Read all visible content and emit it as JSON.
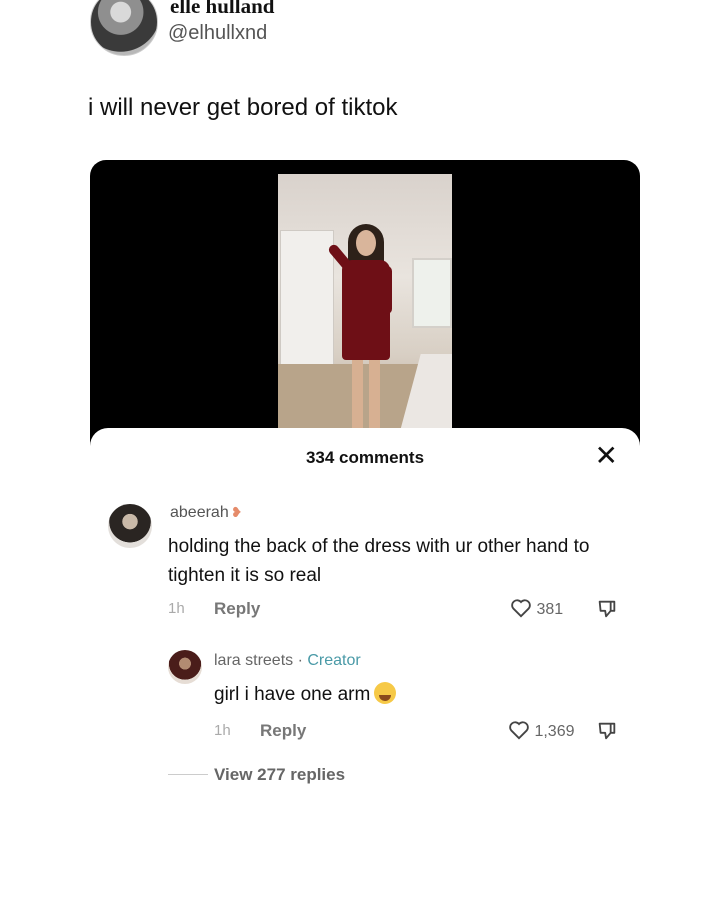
{
  "tweet": {
    "name": "elle hulland",
    "handle": "@elhullxnd",
    "text": "i will never get bored of tiktok"
  },
  "tiktok": {
    "comments_count": "334 comments",
    "close_symbol": "✕",
    "comments": [
      {
        "username": "abeerah",
        "text": "holding the back of the dress with ur other hand to tighten it is so real",
        "time": "1h",
        "reply_label": "Reply",
        "likes": "381"
      }
    ],
    "reply": {
      "username": "lara streets",
      "separator": " · ",
      "badge": "Creator",
      "text": "girl i have one arm",
      "time": "1h",
      "reply_label": "Reply",
      "likes": "1,369"
    },
    "view_replies": "View 277 replies"
  },
  "colors": {
    "creator_badge": "#4a9aa7",
    "dress": "#6e0f16",
    "media_bg": "#000000"
  },
  "icons": [
    "heart-icon",
    "dislike-icon",
    "close-icon",
    "heart-hands-emoji",
    "crying-emoji"
  ]
}
